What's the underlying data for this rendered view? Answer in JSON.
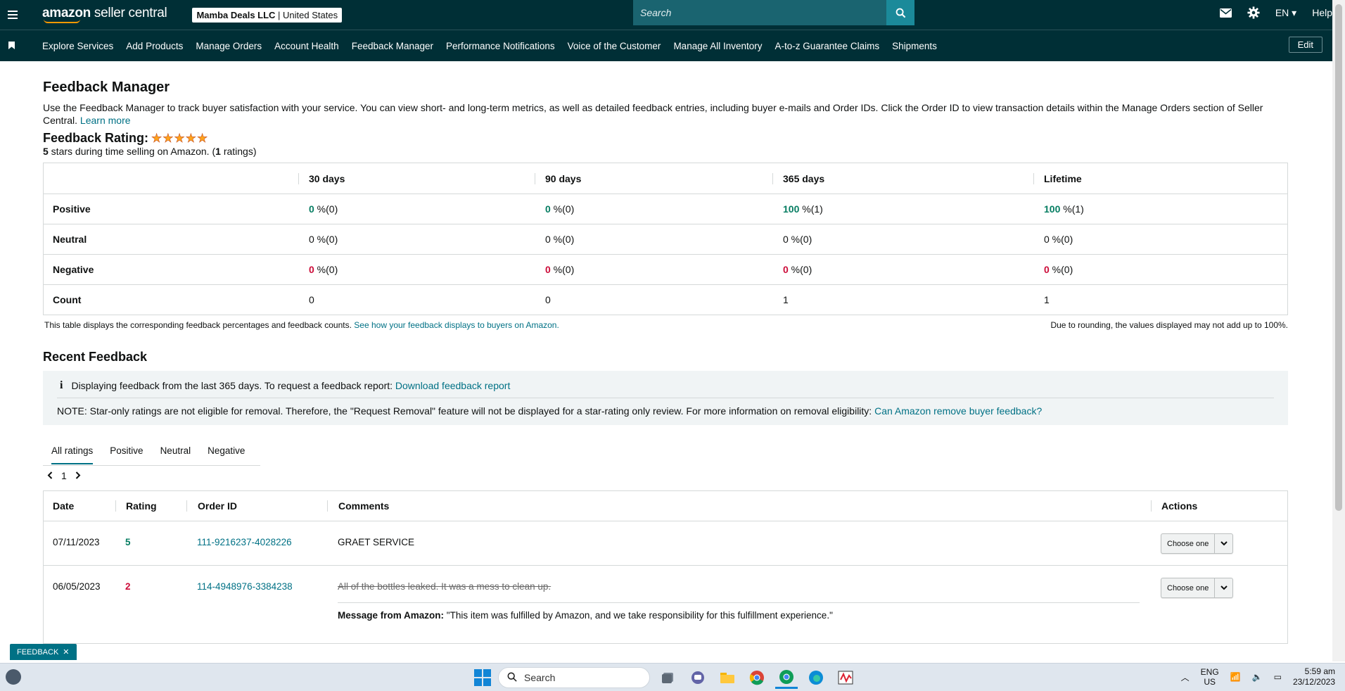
{
  "topbar": {
    "logo_bold": "amazon",
    "logo_rest": " seller central",
    "store_name": "Mamba Deals LLC",
    "store_region": " | United States",
    "search_placeholder": "Search",
    "lang": "EN",
    "help": "Help"
  },
  "nav": {
    "items": [
      "Explore Services",
      "Add Products",
      "Manage Orders",
      "Account Health",
      "Feedback Manager",
      "Performance Notifications",
      "Voice of the Customer",
      "Manage All Inventory",
      "A-to-z Guarantee Claims",
      "Shipments"
    ],
    "edit": "Edit"
  },
  "page": {
    "title": "Feedback Manager",
    "intro": "Use the Feedback Manager to track buyer satisfaction with your service. You can view short- and long-term metrics, as well as detailed feedback entries, including buyer e-mails and Order IDs. Click the Order ID to view transaction details within the Manage Orders section of Seller Central.",
    "learn_more": "Learn more",
    "rating_title": "Feedback Rating:",
    "stars": 5,
    "rating_stars": "5",
    "rating_mid": " stars during time selling on Amazon. (",
    "rating_count": "1",
    "rating_end": " ratings)"
  },
  "summary": {
    "headers": [
      "",
      "30 days",
      "90 days",
      "365 days",
      "Lifetime"
    ],
    "rows": [
      {
        "label": "Positive",
        "cells": [
          {
            "num": "0",
            "rest": " %(0)"
          },
          {
            "num": "0",
            "rest": " %(0)"
          },
          {
            "num": "100",
            "rest": " %(1)"
          },
          {
            "num": "100",
            "rest": " %(1)"
          }
        ]
      },
      {
        "label": "Neutral",
        "cells": [
          {
            "num": "0",
            "rest": " %(0)"
          },
          {
            "num": "0",
            "rest": " %(0)"
          },
          {
            "num": "0",
            "rest": " %(0)"
          },
          {
            "num": "0",
            "rest": " %(0)"
          }
        ]
      },
      {
        "label": "Negative",
        "cells": [
          {
            "num": "0",
            "rest": " %(0)"
          },
          {
            "num": "0",
            "rest": " %(0)"
          },
          {
            "num": "0",
            "rest": " %(0)"
          },
          {
            "num": "0",
            "rest": " %(0)"
          }
        ]
      },
      {
        "label": "Count",
        "cells": [
          {
            "num": "",
            "rest": "0"
          },
          {
            "num": "",
            "rest": "0"
          },
          {
            "num": "",
            "rest": "1"
          },
          {
            "num": "",
            "rest": "1"
          }
        ]
      }
    ],
    "note": "This table displays the corresponding feedback percentages and feedback counts.",
    "note_link": "See how your feedback displays to buyers on Amazon.",
    "rounding": "Due to rounding, the values displayed may not add up to 100%."
  },
  "recent": {
    "title": "Recent Feedback",
    "info_text": "Displaying feedback from the last 365 days. To request a feedback report:",
    "info_link": "Download feedback report",
    "note_text": "NOTE: Star-only ratings are not eligible for removal. Therefore, the \"Request Removal\" feature will not be displayed for a star-rating only review. For more information on removal eligibility:",
    "note_link": "Can Amazon remove buyer feedback?",
    "tabs": [
      "All ratings",
      "Positive",
      "Neutral",
      "Negative"
    ],
    "page": "1",
    "columns": [
      "Date",
      "Rating",
      "Order ID",
      "Comments",
      "Actions"
    ],
    "rows": [
      {
        "date": "07/11/2023",
        "rating": "5",
        "order": "111-9216237-4028226",
        "comment": "GRAET SERVICE",
        "action": "Choose one"
      },
      {
        "date": "06/05/2023",
        "rating": "2",
        "order": "114-4948976-3384238",
        "comment": "All of the bottles leaked. It was a mess to clean up.",
        "msg_label": "Message from Amazon:",
        "msg_text": " \"This item was fulfilled by Amazon, and we take responsibility for this fulfillment experience.\"",
        "action": "Choose one"
      }
    ]
  },
  "feedback_tag": "FEEDBACK",
  "taskbar": {
    "search": "Search",
    "lang1": "ENG",
    "lang2": "US",
    "time": "5:59 am",
    "date": "23/12/2023"
  },
  "colors": {
    "header_bg": "#002f36",
    "link": "#007185",
    "positive": "#067d62",
    "negative": "#cc0c39",
    "star": "#ffa41c"
  }
}
